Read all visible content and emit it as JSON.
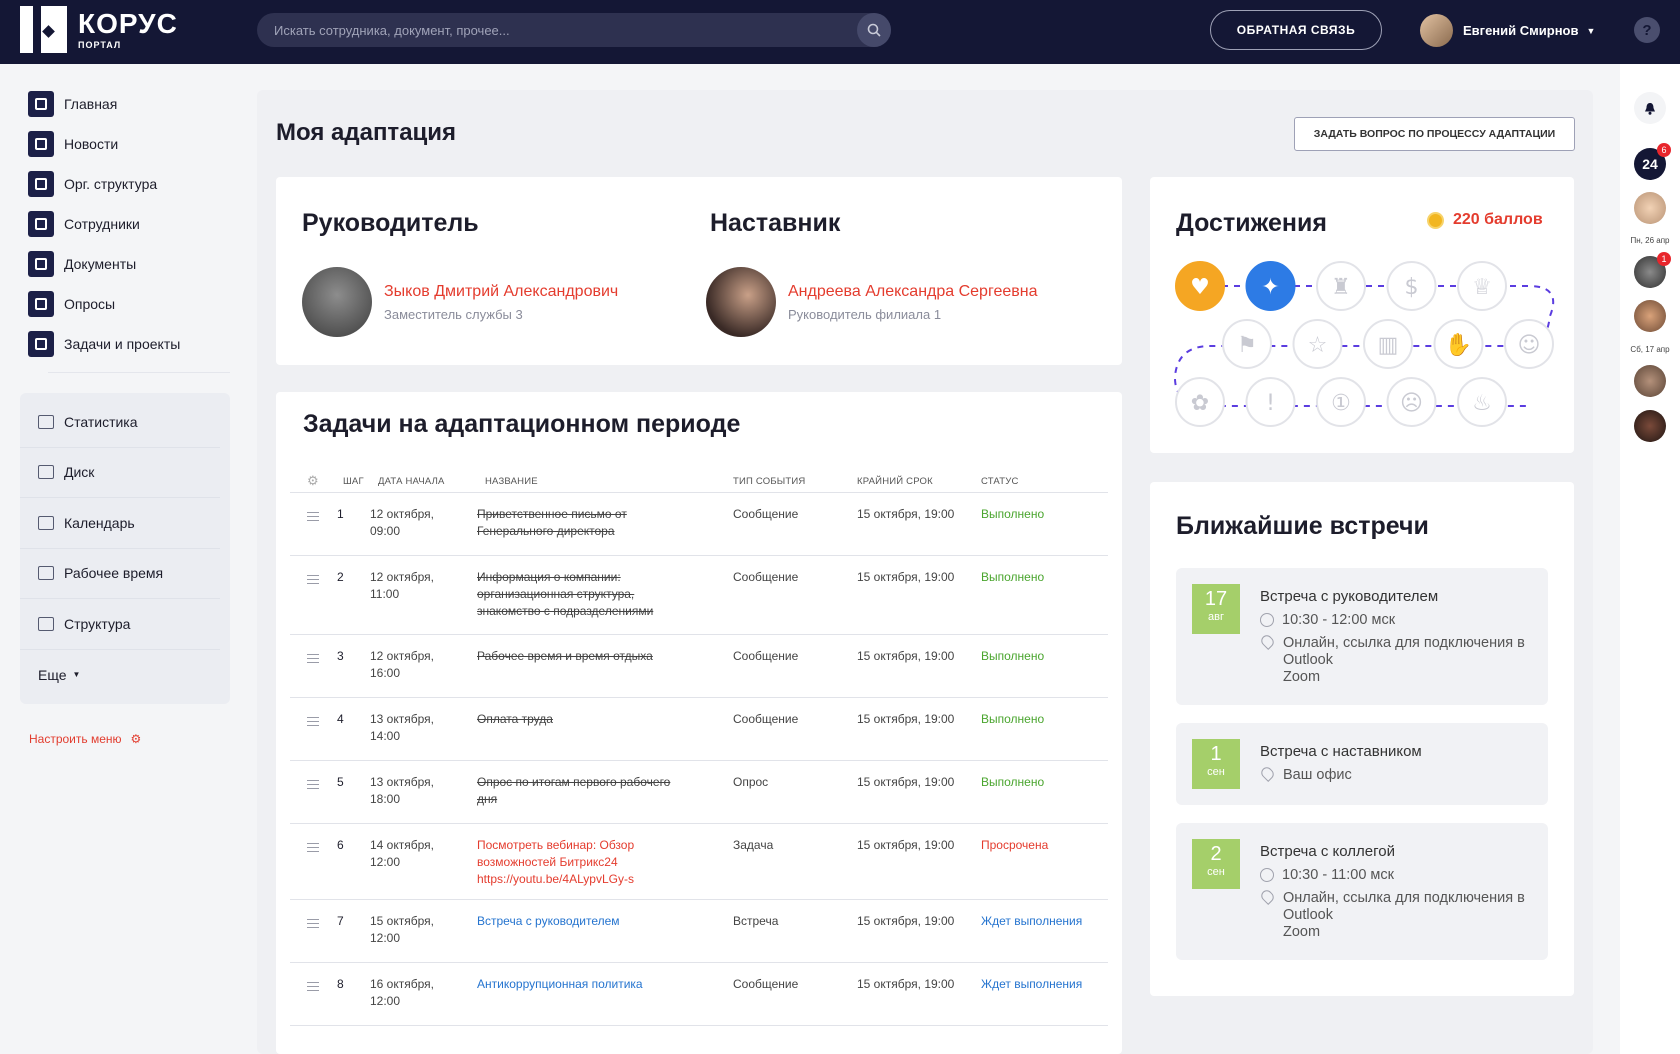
{
  "header": {
    "logo_title": "КОРУС",
    "logo_subtitle": "ПОРТАЛ",
    "search_placeholder": "Искать сотрудника, документ, прочее...",
    "feedback_label": "ОБРАТНАЯ СВЯЗЬ",
    "user_name": "Евгений Смирнов",
    "help_label": "?"
  },
  "sidebar": {
    "items": [
      {
        "label": "Главная",
        "icon": "home-icon"
      },
      {
        "label": "Новости",
        "icon": "news-icon"
      },
      {
        "label": "Орг. структура",
        "icon": "org-structure-icon"
      },
      {
        "label": "Сотрудники",
        "icon": "employees-icon"
      },
      {
        "label": "Документы",
        "icon": "documents-icon"
      },
      {
        "label": "Опросы",
        "icon": "polls-icon"
      },
      {
        "label": "Задачи и проекты",
        "icon": "tasks-icon"
      }
    ],
    "box_items": [
      {
        "label": "Статистика",
        "icon": "statistics-icon"
      },
      {
        "label": "Диск",
        "icon": "disk-icon"
      },
      {
        "label": "Календарь",
        "icon": "calendar-icon"
      },
      {
        "label": "Рабочее время",
        "icon": "clock-icon"
      },
      {
        "label": "Структура",
        "icon": "structure-icon"
      },
      {
        "label": "Еще",
        "icon": "chevron-down-icon"
      }
    ],
    "setup_menu": "Настроить меню"
  },
  "page": {
    "title": "Моя адаптация",
    "ask_button": "ЗАДАТЬ ВОПРОС  ПО ПРОЦЕССУ АДАПТАЦИИ"
  },
  "people": {
    "manager_heading": "Руководитель",
    "manager_name": "Зыков Дмитрий Александрович",
    "manager_role": "Заместитель службы 3",
    "mentor_heading": "Наставник",
    "mentor_name": "Андреева Александра Сергеевна",
    "mentor_role": "Руководитель филиала 1"
  },
  "achievements": {
    "heading": "Достижения",
    "points": "220 баллов",
    "icons": [
      "heart-icon",
      "compass-icon",
      "trophy-icon",
      "money-bag-icon",
      "crown-icon",
      "smile-icon",
      "hand-icon",
      "beer-icon",
      "star-icon",
      "flag-icon",
      "flower-icon",
      "exclamation-icon",
      "one-icon",
      "neutral-face-icon",
      "cake-icon"
    ],
    "earned_count": 2,
    "colors": {
      "earned_first": "#f5a623",
      "earned_second": "#2d7be5",
      "path": "#5b3de0"
    }
  },
  "tasks": {
    "heading": "Задачи на адаптационном периоде",
    "columns": {
      "step": "ШАГ",
      "start": "ДАТА НАЧАЛА",
      "name": "НАЗВАНИЕ",
      "type": "ТИП СОБЫТИЯ",
      "deadline": "КРАЙНИЙ СРОК",
      "status": "СТАТУС"
    },
    "rows": [
      {
        "step": "1",
        "start": "12 октября,\n09:00",
        "name": "Приветственное письмо от\nГенерального директора",
        "type": "Сообщение",
        "deadline": "15 октября, 19:00",
        "status": "Выполнено",
        "state": "done"
      },
      {
        "step": "2",
        "start": "12 октября,\n11:00",
        "name": "Информация о компании:\nорганизационная структура,\nзнакомство с подразделениями",
        "type": "Сообщение",
        "deadline": "15 октября, 19:00",
        "status": "Выполнено",
        "state": "done"
      },
      {
        "step": "3",
        "start": "12 октября,\n16:00",
        "name": "Рабочее время и время отдыха",
        "type": "Сообщение",
        "deadline": "15 октября, 19:00",
        "status": "Выполнено",
        "state": "done"
      },
      {
        "step": "4",
        "start": "13 октября,\n14:00",
        "name": "Оплата труда",
        "type": "Сообщение",
        "deadline": "15 октября, 19:00",
        "status": "Выполнено",
        "state": "done"
      },
      {
        "step": "5",
        "start": "13 октября,\n18:00",
        "name": "Опрос по итогам первого рабочего\nдня",
        "type": "Опрос",
        "deadline": "15 октября, 19:00",
        "status": "Выполнено",
        "state": "done"
      },
      {
        "step": "6",
        "start": "14 октября,\n12:00",
        "name": "Посмотреть вебинар: Обзор\nвозможностей Битрикс24\nhttps://youtu.be/4ALypvLGy-s",
        "type": "Задача",
        "deadline": "15 октября, 19:00",
        "status": "Просрочена",
        "state": "over"
      },
      {
        "step": "7",
        "start": "15 октября,\n12:00",
        "name": "Встреча с руководителем",
        "type": "Встреча",
        "deadline": "15 октября, 19:00",
        "status": "Ждет выполнения",
        "state": "wait"
      },
      {
        "step": "8",
        "start": "16 октября,\n12:00",
        "name": "Антикоррупционная политика",
        "type": "Сообщение",
        "deadline": "15 октября, 19:00",
        "status": "Ждет выполнения",
        "state": "wait"
      }
    ]
  },
  "meetings": {
    "heading": "Ближайшие встречи",
    "items": [
      {
        "day": "17",
        "month": "авг",
        "title": "Встреча с руководителем",
        "time": "10:30 - 12:00 мск",
        "place": "Онлайн, ссылка для подключения в\nOutlook\nZoom"
      },
      {
        "day": "1",
        "month": "сен",
        "title": "Встреча с наставником",
        "time": "",
        "place": "Ваш офис"
      },
      {
        "day": "2",
        "month": "сен",
        "title": "Встреча с коллегой",
        "time": "10:30 - 11:00 мск",
        "place": "Онлайн, ссылка для подключения в\nOutlook\nZoom"
      }
    ]
  },
  "rightbar": {
    "app_label": "24",
    "app_badge": "6",
    "badge2": "1",
    "date1": "Пн, 26 апр",
    "date2": "Сб, 17 апр"
  }
}
